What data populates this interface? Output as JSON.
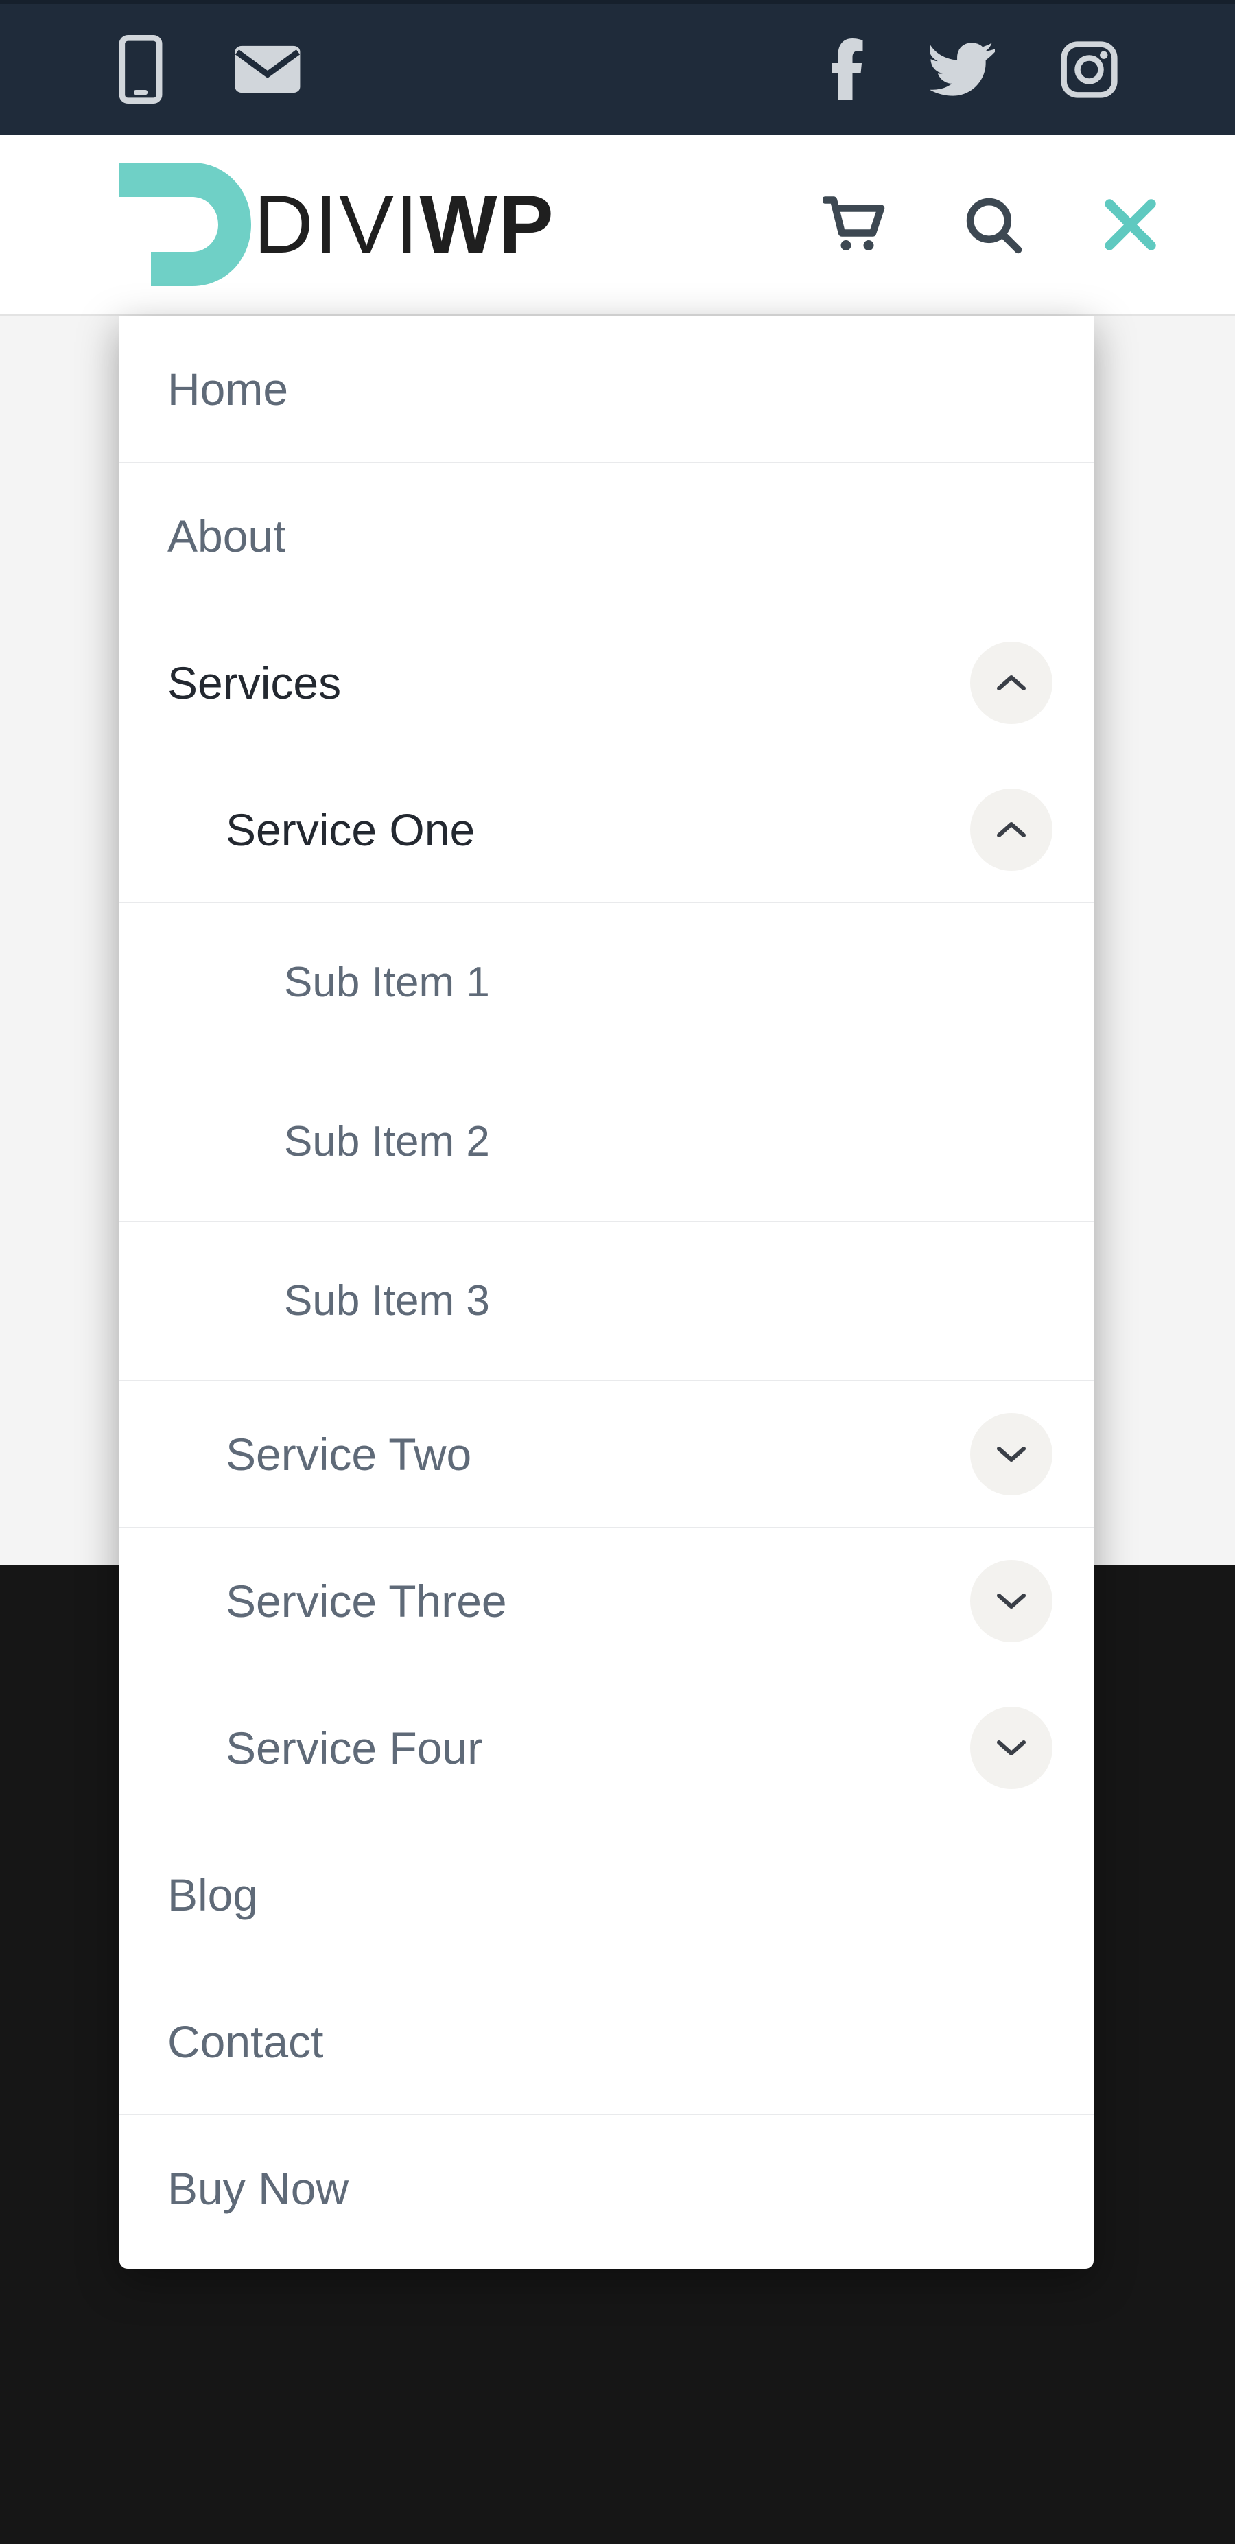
{
  "brand": {
    "name_part1": "DIVI",
    "name_part2": "WP",
    "accent_color": "#5fc9c0"
  },
  "topbar": {
    "social": [
      "facebook",
      "twitter",
      "instagram"
    ],
    "contact": [
      "phone",
      "email"
    ]
  },
  "header": {
    "icons": [
      "cart",
      "search",
      "close"
    ]
  },
  "menu": {
    "items": [
      {
        "label": "Home",
        "level": 1,
        "active": false,
        "toggle": null
      },
      {
        "label": "About",
        "level": 1,
        "active": false,
        "toggle": null
      },
      {
        "label": "Services",
        "level": 1,
        "active": true,
        "toggle": "up"
      },
      {
        "label": "Service One",
        "level": 2,
        "active": true,
        "toggle": "up"
      },
      {
        "label": "Sub Item 1",
        "level": 3,
        "active": false,
        "toggle": null
      },
      {
        "label": "Sub Item 2",
        "level": 3,
        "active": false,
        "toggle": null
      },
      {
        "label": "Sub Item 3",
        "level": 3,
        "active": false,
        "toggle": null
      },
      {
        "label": "Service Two",
        "level": 2,
        "active": false,
        "toggle": "down"
      },
      {
        "label": "Service Three",
        "level": 2,
        "active": false,
        "toggle": "down"
      },
      {
        "label": "Service Four",
        "level": 2,
        "active": false,
        "toggle": "down"
      },
      {
        "label": "Blog",
        "level": 1,
        "active": false,
        "toggle": null
      },
      {
        "label": "Contact",
        "level": 1,
        "active": false,
        "toggle": null
      },
      {
        "label": "Buy Now",
        "level": 1,
        "active": false,
        "toggle": null
      }
    ]
  }
}
